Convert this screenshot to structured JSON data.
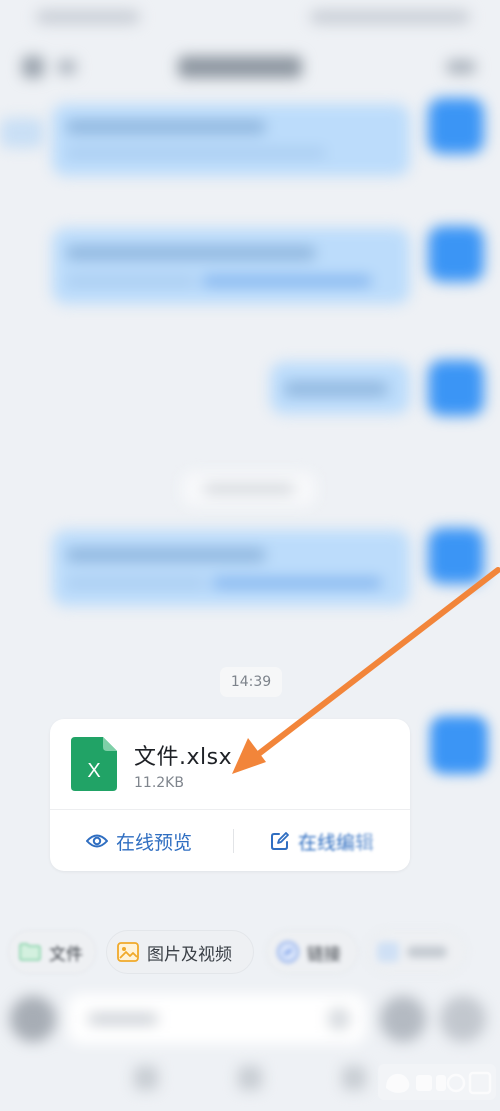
{
  "timestamp": "14:39",
  "file_card": {
    "file_name": "文件.xlsx",
    "file_size": "11.2KB",
    "icon_letter": "X",
    "preview_label": "在线预览",
    "edit_label": "在线编辑"
  },
  "quick_actions": {
    "files_label": "文件",
    "media_label": "图片及视频",
    "link_label": "链接"
  },
  "colors": {
    "accent": "#2f6ec1",
    "excel_green": "#21a366",
    "arrow": "#f2853a",
    "avatar_blue": "#3b95f5"
  }
}
